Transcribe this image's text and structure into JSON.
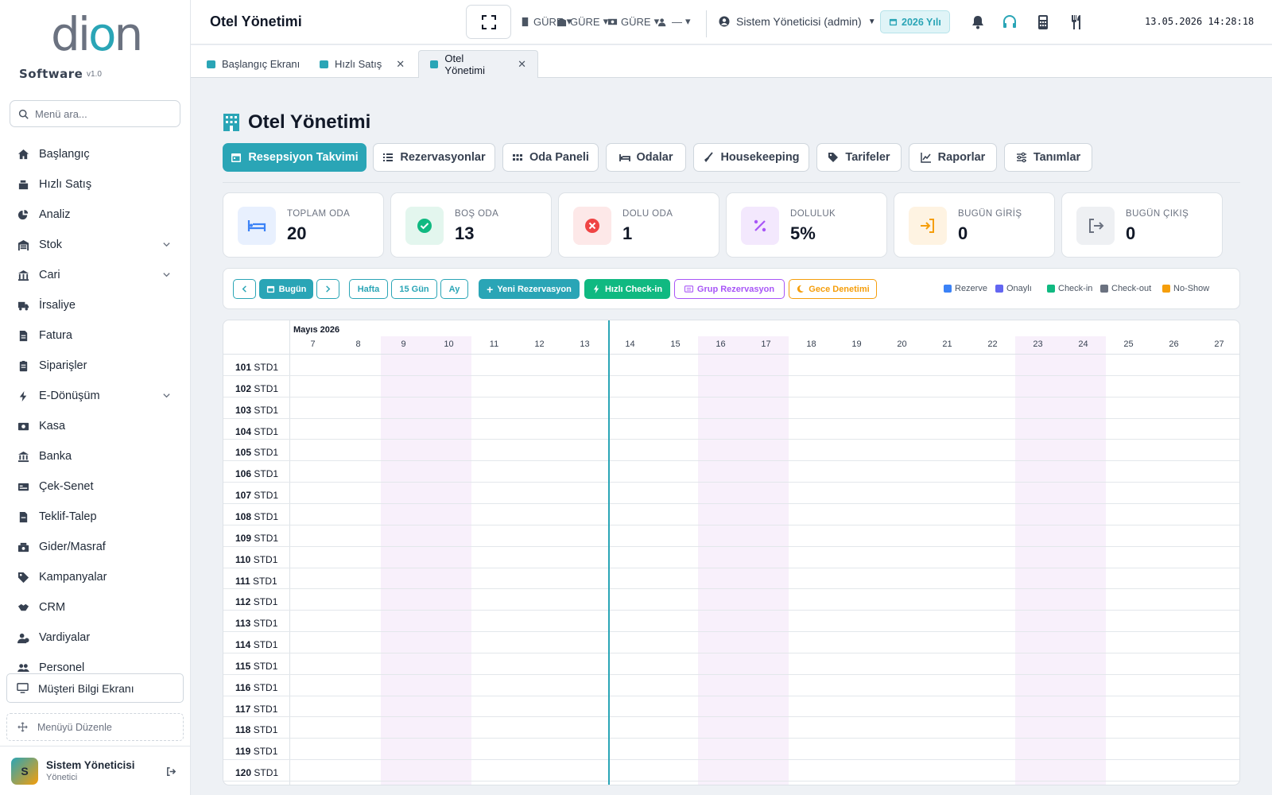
{
  "brand": {
    "logo_text": "dion",
    "name": "Software",
    "version": "v1.0"
  },
  "sidebar": {
    "search_placeholder": "Menü ara...",
    "items": [
      {
        "label": "Başlangıç",
        "icon": "home-icon"
      },
      {
        "label": "Hızlı Satış",
        "icon": "cash-register-icon"
      },
      {
        "label": "Analiz",
        "icon": "pie-chart-icon"
      },
      {
        "label": "Stok",
        "icon": "warehouse-icon",
        "expandable": true
      },
      {
        "label": "Cari",
        "icon": "building-icon",
        "expandable": true
      },
      {
        "label": "İrsaliye",
        "icon": "truck-icon"
      },
      {
        "label": "Fatura",
        "icon": "invoice-icon"
      },
      {
        "label": "Siparişler",
        "icon": "clipboard-icon"
      },
      {
        "label": "E-Dönüşüm",
        "icon": "bolt-icon",
        "expandable": true
      },
      {
        "label": "Kasa",
        "icon": "cash-icon"
      },
      {
        "label": "Banka",
        "icon": "bank-icon"
      },
      {
        "label": "Çek-Senet",
        "icon": "money-check-icon"
      },
      {
        "label": "Teklif-Talep",
        "icon": "file-icon"
      },
      {
        "label": "Gider/Masraf",
        "icon": "expense-icon"
      },
      {
        "label": "Kampanyalar",
        "icon": "tags-icon"
      },
      {
        "label": "CRM",
        "icon": "handshake-icon"
      },
      {
        "label": "Vardiyalar",
        "icon": "users-clock-icon"
      },
      {
        "label": "Personel",
        "icon": "users-icon"
      }
    ],
    "customer_screen": "Müşteri Bilgi Ekranı",
    "menu_edit": "Menüyü Düzenle",
    "user": {
      "initial": "S",
      "name": "Sistem Yöneticisi",
      "role": "Yönetici"
    }
  },
  "topbar": {
    "title": "Otel Yönetimi",
    "selectors": [
      "GÜRE",
      "GÜRE",
      "GÜRE",
      "—"
    ],
    "admin": "Sistem Yöneticisi (admin)",
    "year": "2026 Yılı",
    "datetime": "13.05.2026 14:28:18"
  },
  "tabs": [
    {
      "label": "Başlangıç Ekranı",
      "closable": false
    },
    {
      "label": "Hızlı Satış",
      "closable": true
    },
    {
      "label": "Otel Yönetimi",
      "closable": true,
      "active": true
    }
  ],
  "page": {
    "title": "Otel Yönetimi",
    "nav": [
      "Resepsiyon Takvimi",
      "Rezervasyonlar",
      "Oda Paneli",
      "Odalar",
      "Housekeeping",
      "Tarifeler",
      "Raporlar",
      "Tanımlar"
    ],
    "stats": [
      {
        "label": "TOPLAM ODA",
        "value": "20",
        "color": "#3b82f6",
        "bg": "#e8f0fe"
      },
      {
        "label": "BOŞ ODA",
        "value": "13",
        "color": "#10b981",
        "bg": "#e3f6ee"
      },
      {
        "label": "DOLU ODA",
        "value": "1",
        "color": "#ef4444",
        "bg": "#fde8e8"
      },
      {
        "label": "DOLULUK",
        "value": "5%",
        "color": "#a855f7",
        "bg": "#f3e8fd"
      },
      {
        "label": "BUGÜN GİRİŞ",
        "value": "0",
        "color": "#f59e0b",
        "bg": "#fef3e2"
      },
      {
        "label": "BUGÜN ÇIKIŞ",
        "value": "0",
        "color": "#6b7280",
        "bg": "#eef0f3"
      }
    ],
    "toolbar": {
      "today": "Bugün",
      "week": "Hafta",
      "days15": "15 Gün",
      "month": "Ay",
      "new_res": "Yeni Rezervasyon",
      "quick_checkin": "Hızlı Check-in",
      "group_res": "Grup Rezervasyon",
      "night_audit": "Gece Denetimi"
    },
    "legend": [
      {
        "label": "Rezerve",
        "color": "#3b82f6"
      },
      {
        "label": "Onaylı",
        "color": "#6366f1"
      },
      {
        "label": "Check-in",
        "color": "#10b981"
      },
      {
        "label": "Check-out",
        "color": "#6b7280"
      },
      {
        "label": "No-Show",
        "color": "#f59e0b"
      }
    ],
    "calendar": {
      "month": "Mayıs 2026",
      "days": [
        "7",
        "8",
        "9",
        "10",
        "11",
        "12",
        "13",
        "14",
        "15",
        "16",
        "17",
        "18",
        "19",
        "20",
        "21",
        "22",
        "23",
        "24",
        "25",
        "26",
        "27"
      ],
      "rooms": [
        {
          "no": "101",
          "type": "STD1"
        },
        {
          "no": "102",
          "type": "STD1"
        },
        {
          "no": "103",
          "type": "STD1"
        },
        {
          "no": "104",
          "type": "STD1"
        },
        {
          "no": "105",
          "type": "STD1"
        },
        {
          "no": "106",
          "type": "STD1"
        },
        {
          "no": "107",
          "type": "STD1"
        },
        {
          "no": "108",
          "type": "STD1"
        },
        {
          "no": "109",
          "type": "STD1"
        },
        {
          "no": "110",
          "type": "STD1"
        },
        {
          "no": "111",
          "type": "STD1"
        },
        {
          "no": "112",
          "type": "STD1"
        },
        {
          "no": "113",
          "type": "STD1"
        },
        {
          "no": "114",
          "type": "STD1"
        },
        {
          "no": "115",
          "type": "STD1"
        },
        {
          "no": "116",
          "type": "STD1"
        },
        {
          "no": "117",
          "type": "STD1"
        },
        {
          "no": "118",
          "type": "STD1"
        },
        {
          "no": "119",
          "type": "STD1"
        },
        {
          "no": "120",
          "type": "STD1"
        }
      ]
    }
  }
}
